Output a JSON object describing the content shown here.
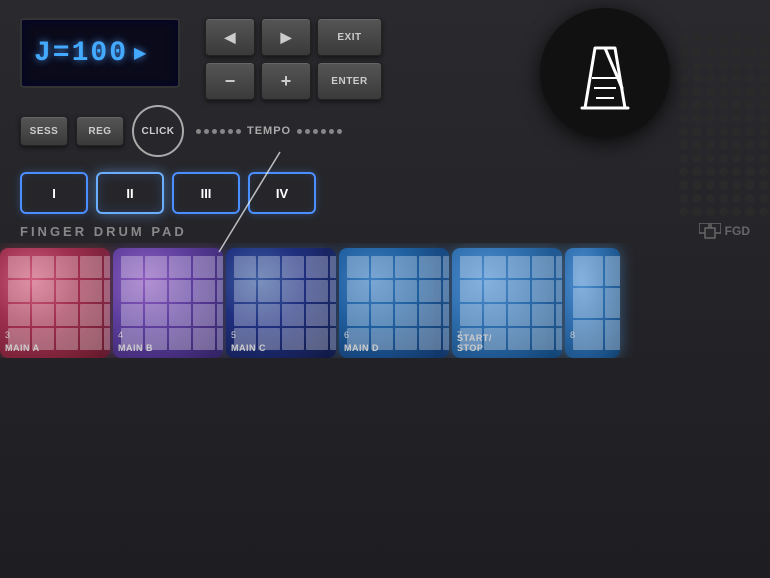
{
  "device": {
    "title": "Finger Drum Pad",
    "brand": "FGD"
  },
  "display": {
    "bpm": "J=100",
    "arrow": "▶"
  },
  "nav_buttons": {
    "prev": "◀",
    "next": "▶",
    "exit": "EXIT",
    "minus": "−",
    "plus": "+",
    "enter": "ENTER"
  },
  "control_buttons": {
    "sess": "SESS",
    "reg": "REG",
    "click": "CLICK",
    "tempo": "TEMPO"
  },
  "pad_groups": [
    "I",
    "II",
    "III",
    "IV"
  ],
  "label": {
    "finger_drum_pad": "FINGER DRUM PAD",
    "brand_logo": "FGD"
  },
  "pads": [
    {
      "number": "3",
      "name": "MAIN A",
      "color": "pink"
    },
    {
      "number": "4",
      "name": "MAIN B",
      "color": "purple"
    },
    {
      "number": "5",
      "name": "MAIN C",
      "color": "blue-dark"
    },
    {
      "number": "6",
      "name": "MAIN D",
      "color": "blue"
    },
    {
      "number": "7",
      "name": "START/\nSTOP",
      "color": "blue-light"
    },
    {
      "number": "8",
      "name": "",
      "color": "blue-light"
    }
  ],
  "metronome": {
    "aria_label": "Metronome icon"
  },
  "colors": {
    "accent_blue": "#4a8fff",
    "lcd_blue": "#44aaff",
    "bg_dark": "#1e1e22"
  }
}
